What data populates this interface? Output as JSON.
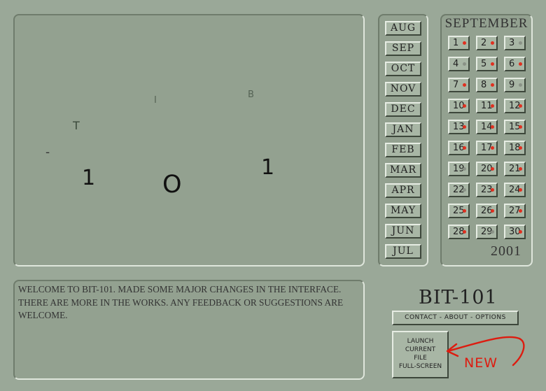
{
  "stage": {
    "glyphs": [
      {
        "id": "dash",
        "char": "-"
      },
      {
        "id": "t",
        "char": "T"
      },
      {
        "id": "i",
        "char": "I"
      },
      {
        "id": "b",
        "char": "B"
      },
      {
        "id": "one-left",
        "char": "1"
      },
      {
        "id": "zero",
        "char": "O"
      },
      {
        "id": "one-right",
        "char": "1"
      }
    ]
  },
  "months": [
    "AUG",
    "SEP",
    "OCT",
    "NOV",
    "DEC",
    "JAN",
    "FEB",
    "MAR",
    "APR",
    "MAY",
    "JUN",
    "JUL"
  ],
  "calendar": {
    "title": "SEPTEMBER",
    "year": "2001",
    "days": [
      {
        "label": "1",
        "dot": "red"
      },
      {
        "label": "2",
        "dot": "red"
      },
      {
        "label": "3",
        "dot": "gray"
      },
      {
        "label": "4",
        "dot": "gray"
      },
      {
        "label": "5",
        "dot": "red"
      },
      {
        "label": "6",
        "dot": "red"
      },
      {
        "label": "7",
        "dot": "red"
      },
      {
        "label": "8",
        "dot": "red"
      },
      {
        "label": "9",
        "dot": "gray"
      },
      {
        "label": "10",
        "dot": "red"
      },
      {
        "label": "11",
        "dot": "red"
      },
      {
        "label": "12",
        "dot": "red"
      },
      {
        "label": "13",
        "dot": "red"
      },
      {
        "label": "14",
        "dot": "red"
      },
      {
        "label": "15",
        "dot": "red"
      },
      {
        "label": "16",
        "dot": "red"
      },
      {
        "label": "17",
        "dot": "red"
      },
      {
        "label": "18",
        "dot": "red"
      },
      {
        "label": "19",
        "dot": "gray"
      },
      {
        "label": "20",
        "dot": "red"
      },
      {
        "label": "21",
        "dot": "red"
      },
      {
        "label": "22",
        "dot": "gray"
      },
      {
        "label": "23",
        "dot": "red"
      },
      {
        "label": "24",
        "dot": "red"
      },
      {
        "label": "25",
        "dot": "red"
      },
      {
        "label": "26",
        "dot": "red"
      },
      {
        "label": "27",
        "dot": "red"
      },
      {
        "label": "28",
        "dot": "red"
      },
      {
        "label": "29",
        "dot": "gray"
      },
      {
        "label": "30",
        "dot": "red"
      }
    ]
  },
  "news": {
    "text": "Welcome to BIT-101. Made some major changes in the interface. There are more in the works. Any feedback or suggestions are welcome."
  },
  "brand": "BIT-101",
  "links_label": "contact - about - options",
  "launch": {
    "lines": [
      "Launch",
      "current",
      "file",
      "full-screen"
    ]
  },
  "new_label": "NEW",
  "colors": {
    "background": "#9aa898",
    "panel": "#93a190",
    "button": "#a8b6a5",
    "dot_active": "#e03020",
    "dot_inactive": "#8a9287",
    "annotation": "#dd1c10"
  },
  "icons": [
    "new-arrow-icon"
  ]
}
